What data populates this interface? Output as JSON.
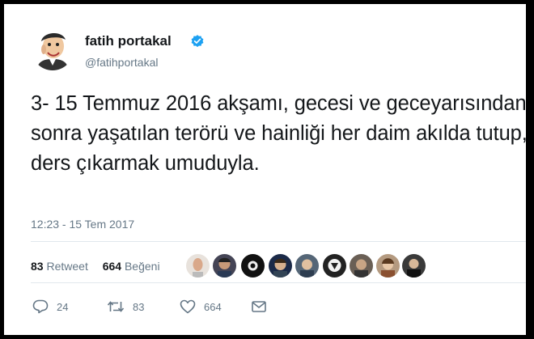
{
  "tweet": {
    "author_name": "fatih portakal",
    "handle": "@fatihportakal",
    "text": "3- 15 Temmuz 2016 akşamı, gecesi ve geceyarısından sonra yaşatılan terörü ve hainliği her daim akılda tutup, ders çıkarmak umuduyla.",
    "timestamp": "12:23 - 15 Tem 2017",
    "retweet_count": "83",
    "retweet_label": "Retweet",
    "like_count": "664",
    "like_label": "Beğeni",
    "reply_count": "24"
  },
  "colors": {
    "verified_badge": "#1da1f2",
    "secondary_text": "#657786",
    "primary_text": "#14171a"
  },
  "icons": {
    "reply": "reply-icon",
    "retweet": "retweet-icon",
    "like": "heart-icon",
    "message": "envelope-icon",
    "verified": "verified-badge-icon"
  }
}
